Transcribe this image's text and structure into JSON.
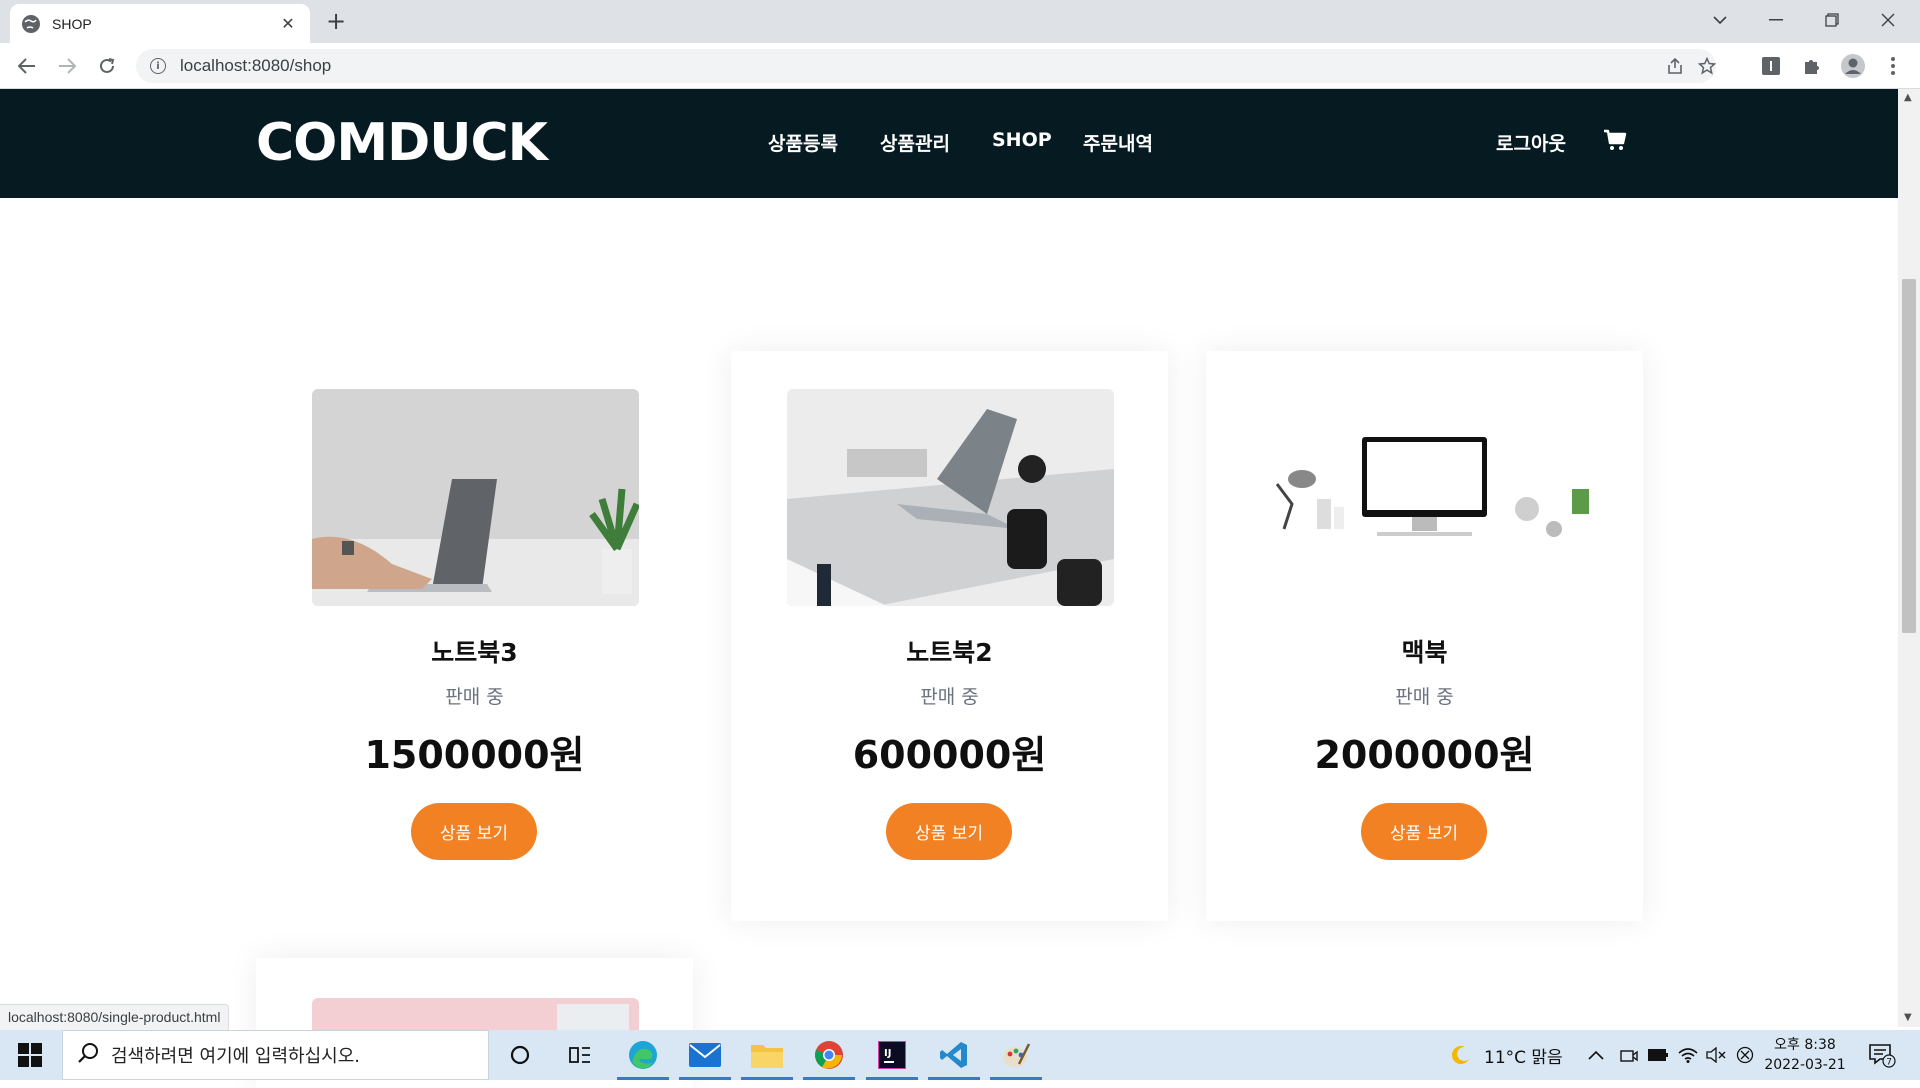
{
  "browser": {
    "tab_title": "SHOP",
    "url": "localhost:8080/shop",
    "status_link": "localhost:8080/single-product.html"
  },
  "site": {
    "logo": "COMDUCK",
    "nav": [
      "상품등록",
      "상품관리",
      "SHOP",
      "주문내역"
    ],
    "logout": "로그아웃"
  },
  "products": [
    {
      "name": "노트북3",
      "status": "판매 중",
      "price": "1500000원",
      "button": "상품 보기"
    },
    {
      "name": "노트북2",
      "status": "판매 중",
      "price": "600000원",
      "button": "상품 보기"
    },
    {
      "name": "맥북",
      "status": "판매 중",
      "price": "2000000원",
      "button": "상품 보기"
    }
  ],
  "taskbar": {
    "search_placeholder": "검색하려면 여기에 입력하십시오.",
    "weather": "11°C 맑음",
    "time": "오후 8:38",
    "date": "2022-03-21",
    "notification_count": "7"
  },
  "colors": {
    "navbar_bg": "#061a22",
    "accent": "#f28123"
  }
}
